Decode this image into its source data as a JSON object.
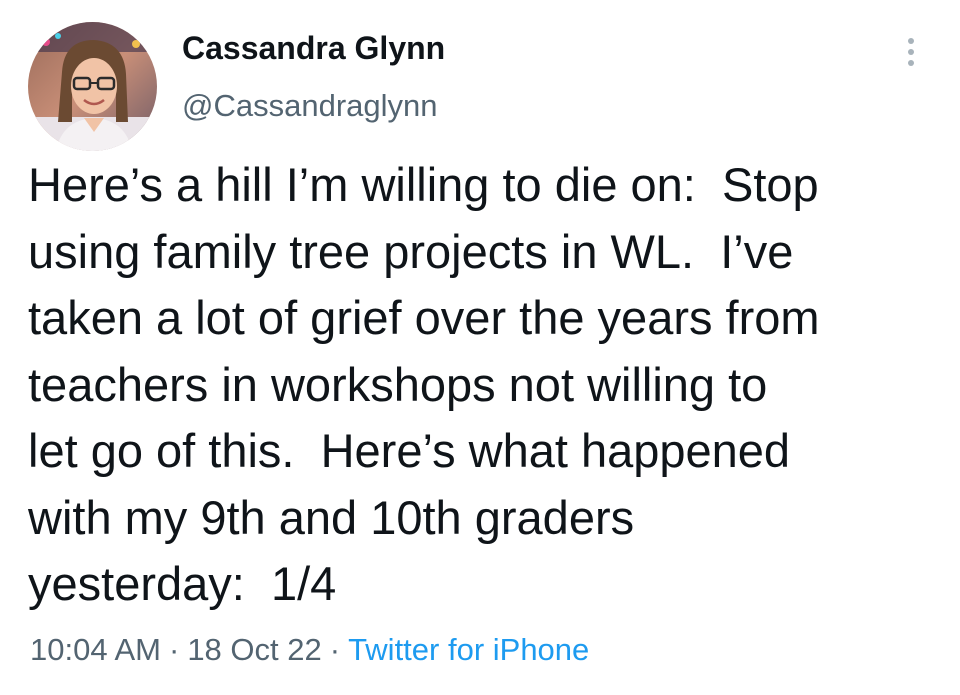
{
  "author": {
    "display_name": "Cassandra Glynn",
    "handle": "@Cassandraglynn",
    "avatar": "profile-photo-avatar"
  },
  "more_icon": "vertical-ellipsis-icon",
  "tweet": {
    "lines": [
      "Here’s a hill I’m willing to die on:  Stop",
      "using family tree projects in WL.  I’ve",
      "taken a lot of grief over the years from",
      "teachers in workshops not willing to",
      "let go of this.  Here’s what happened",
      "with my 9th and 10th graders",
      "yesterday:  1/4"
    ]
  },
  "meta": {
    "time": "10:04 AM",
    "separator": "·",
    "date": "18 Oct 22",
    "source": "Twitter for iPhone"
  },
  "colors": {
    "text": "#0f1419",
    "secondary": "#536471",
    "link": "#1d9bf0"
  }
}
